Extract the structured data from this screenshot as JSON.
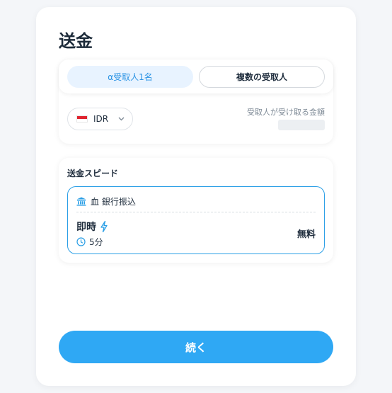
{
  "page": {
    "title": "送金"
  },
  "tabs": {
    "single_label": "α受取人1名",
    "multi_label": "複数の受取人"
  },
  "amount": {
    "currency_code": "IDR",
    "flag_icon": "indonesia-flag-icon",
    "receiver_label": "受取人が受け取る金額",
    "receiver_amount": ""
  },
  "speed": {
    "section_title": "送金スピード",
    "option": {
      "method_label": "血 銀行振込",
      "method_icon": "bank-icon",
      "speed_label": "即時",
      "speed_icon": "lightning-icon",
      "time_label": "5分",
      "time_icon": "clock-icon",
      "fee_label": "無料"
    }
  },
  "footer": {
    "continue_label": "続く"
  },
  "colors": {
    "accent": "#2fa8f4",
    "accent_border": "#2b9fe6",
    "tab_active_bg": "#e8f3ff",
    "tab_active_text": "#2b93e4"
  }
}
